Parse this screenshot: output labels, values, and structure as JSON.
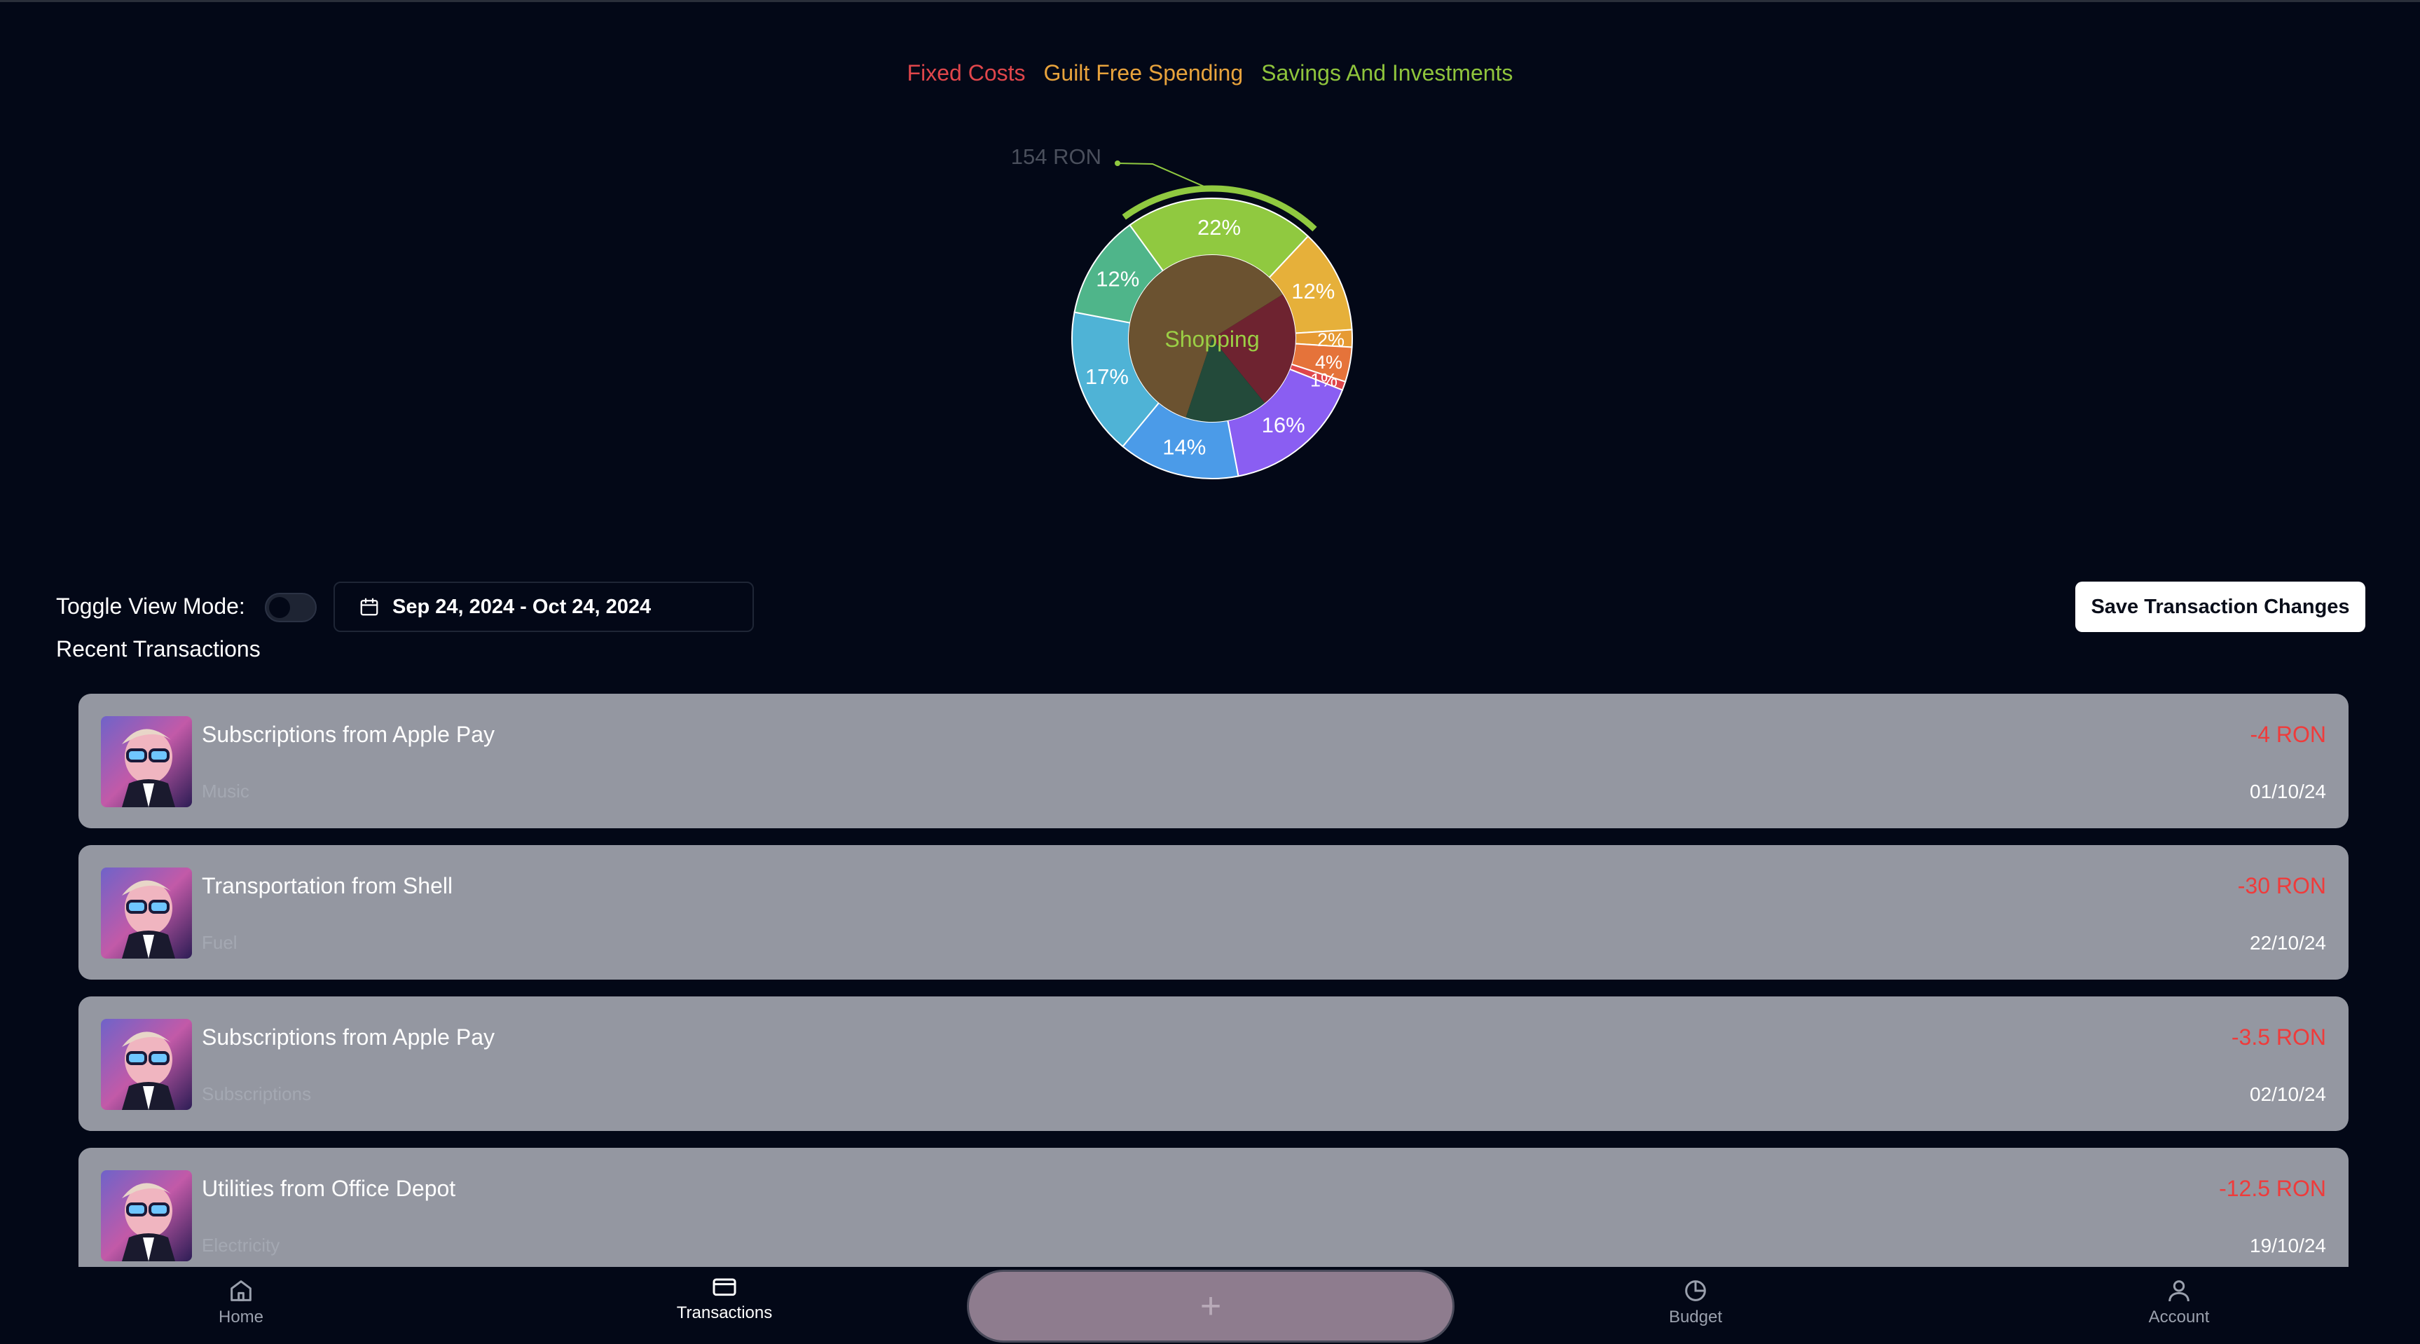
{
  "legend": [
    {
      "label": "Fixed Costs",
      "color": "#e0464b"
    },
    {
      "label": "Guilt Free Spending",
      "color": "#e8a33c"
    },
    {
      "label": "Savings And Investments",
      "color": "#8fc43c"
    }
  ],
  "chart_data": {
    "type": "pie",
    "center_label": "Shopping",
    "hover_callout": "154 RON",
    "outer_ring": [
      {
        "percent": 22,
        "label": "22%",
        "color": "#90c940"
      },
      {
        "percent": 12,
        "label": "12%",
        "color": "#e6b03a"
      },
      {
        "percent": 2,
        "label": "2%",
        "color": "#e69a33"
      },
      {
        "percent": 4,
        "label": "4%",
        "color": "#e5733a"
      },
      {
        "percent": 1,
        "label": "1%",
        "color": "#e0464b"
      },
      {
        "percent": 16,
        "label": "16%",
        "color": "#8a5ef2"
      },
      {
        "percent": 14,
        "label": "14%",
        "color": "#4b9be8"
      },
      {
        "percent": 17,
        "label": "17%",
        "color": "#4fb3d6"
      },
      {
        "percent": 12,
        "label": "12%",
        "color": "#4fb58a"
      }
    ],
    "inner_ring": [
      {
        "percent": 23,
        "color": "#6e2330"
      },
      {
        "percent": 16,
        "color": "#234a3a"
      },
      {
        "percent": 61,
        "color": "#6b5230"
      }
    ]
  },
  "controls": {
    "toggle_label": "Toggle View Mode:",
    "date_range": "Sep 24, 2024 - Oct 24, 2024",
    "save_label": "Save Transaction Changes",
    "recent_title": "Recent Transactions"
  },
  "transactions": [
    {
      "title": "Subscriptions from Apple Pay",
      "subtitle": "Music",
      "amount": "-4 RON",
      "date": "01/10/24"
    },
    {
      "title": "Transportation from Shell",
      "subtitle": "Fuel",
      "amount": "-30 RON",
      "date": "22/10/24"
    },
    {
      "title": "Subscriptions from Apple Pay",
      "subtitle": "Subscriptions",
      "amount": "-3.5 RON",
      "date": "02/10/24"
    },
    {
      "title": "Utilities from Office Depot",
      "subtitle": "Electricity",
      "amount": "-12.5 RON",
      "date": "19/10/24"
    }
  ],
  "nav": {
    "home": "Home",
    "transactions": "Transactions",
    "add": "+",
    "budget": "Budget",
    "account": "Account"
  }
}
